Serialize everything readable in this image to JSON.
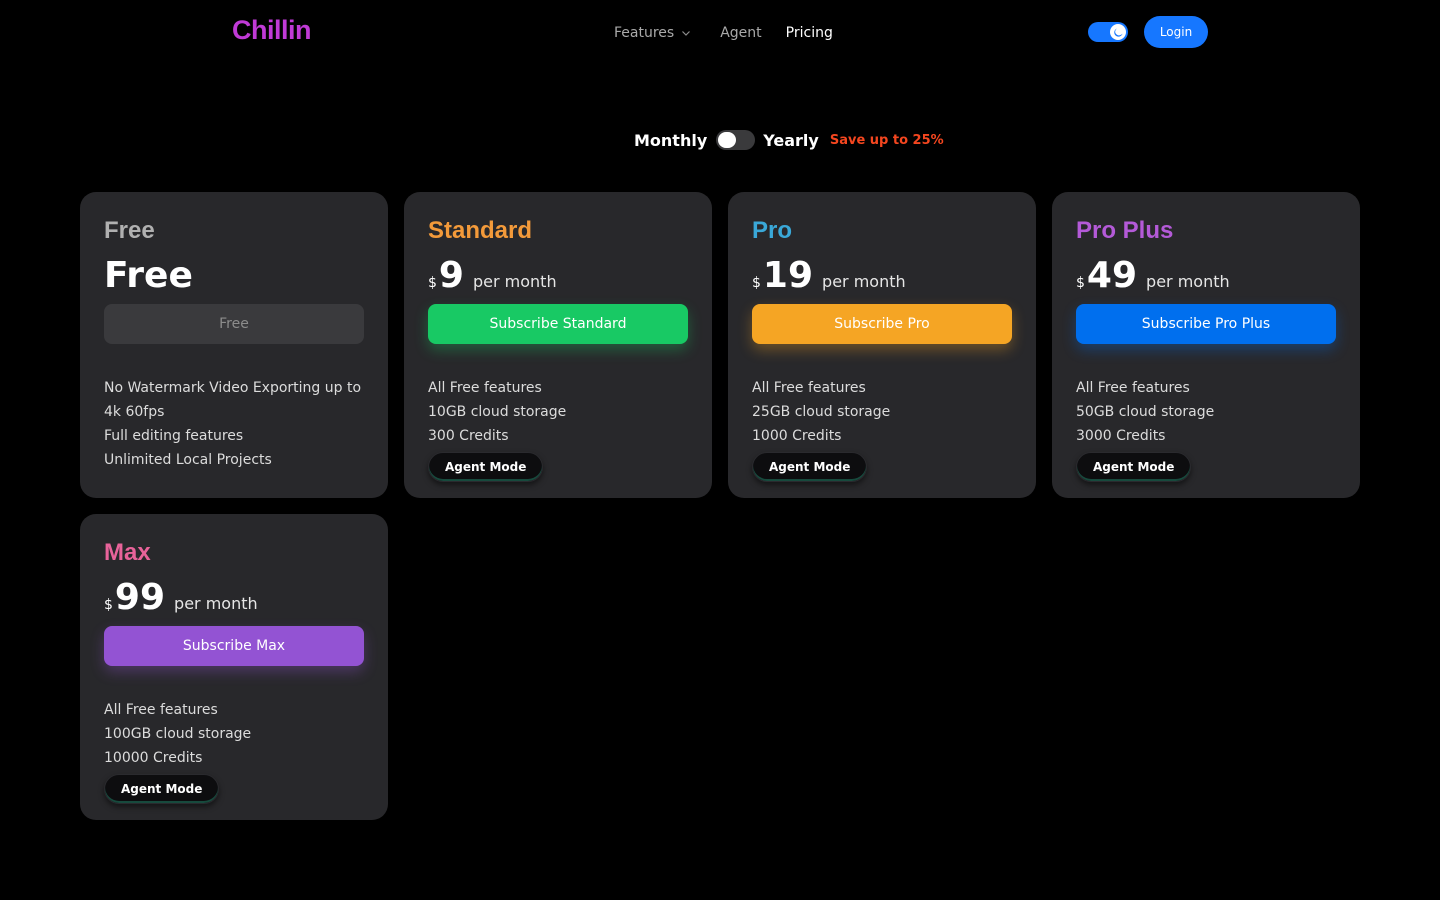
{
  "header": {
    "logo": "Chillin",
    "nav": {
      "features": "Features",
      "agent": "Agent",
      "pricing": "Pricing"
    },
    "login": "Login"
  },
  "billing": {
    "monthly": "Monthly",
    "yearly": "Yearly",
    "save": "Save up to 25%",
    "yearly_enabled": false
  },
  "plans": [
    {
      "name": "Free",
      "name_color": "#b0b0b0",
      "price_text": "Free",
      "button": "Free",
      "features": [
        "No Watermark Video Exporting up to",
        "4k 60fps",
        "Full editing features",
        "Unlimited Local Projects"
      ]
    },
    {
      "name": "Standard",
      "name_color": "#f39a3a",
      "currency": "$",
      "amount": "9",
      "period": "per month",
      "button": "Subscribe Standard",
      "button_color": "#18c964",
      "features": [
        "All Free features",
        "10GB cloud storage",
        "300 Credits"
      ],
      "agent": "Agent Mode"
    },
    {
      "name": "Pro",
      "name_color": "#3aa8d8",
      "currency": "$",
      "amount": "19",
      "period": "per month",
      "button": "Subscribe Pro",
      "button_color": "#f5a524",
      "features": [
        "All Free features",
        "25GB cloud storage",
        "1000 Credits"
      ],
      "agent": "Agent Mode"
    },
    {
      "name": "Pro Plus",
      "name_color": "#b45ad8",
      "currency": "$",
      "amount": "49",
      "period": "per month",
      "button": "Subscribe Pro Plus",
      "button_color": "#006fee",
      "features": [
        "All Free features",
        "50GB cloud storage",
        "3000 Credits"
      ],
      "agent": "Agent Mode"
    },
    {
      "name": "Max",
      "name_color": "#e8639a",
      "currency": "$",
      "amount": "99",
      "period": "per month",
      "button": "Subscribe Max",
      "button_color": "#9353d3",
      "features": [
        "All Free features",
        "100GB cloud storage",
        "10000 Credits"
      ],
      "agent": "Agent Mode"
    }
  ],
  "colors": {
    "background": "#000000",
    "card": "#28282b",
    "brand": "#c03ad6",
    "accent": "#1677ff",
    "save": "#f4461f"
  },
  "icons": {
    "features_dropdown": "chevron-down-icon",
    "theme": "moon-icon"
  }
}
